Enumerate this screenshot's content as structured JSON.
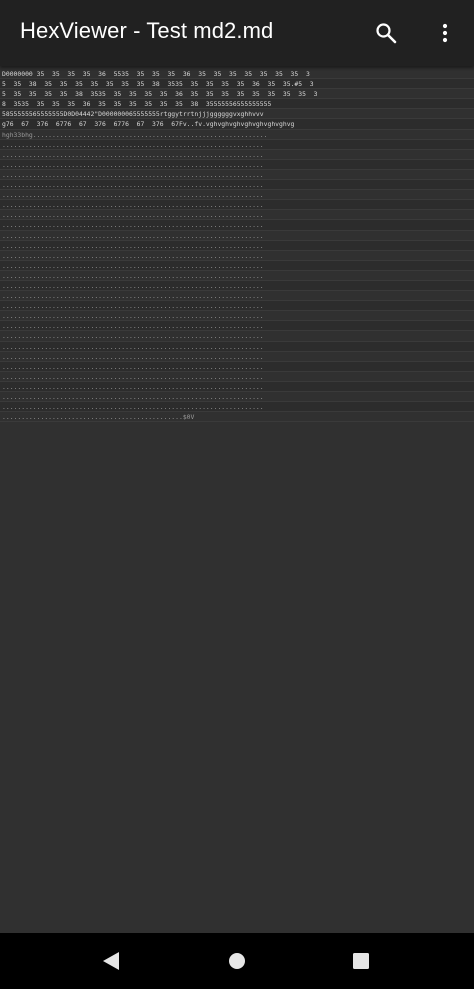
{
  "app_bar": {
    "title": "HexViewer - Test md2.md",
    "search_icon": "search-icon",
    "more_icon": "more-vert-icon"
  },
  "hex": {
    "lines": [
      "D0000000 35  35  35  35  36  5535  35  35  35  36  35  35  35  35  35  35  35  3",
      "5  35  38  35  35  35  35  35  35  35  38  3535  35  35  35  35  36  35  35.#5  3",
      "5  35  35  35  35  38  3535  35  35  35  35  36  35  35  35  35  35  35  35  35  3",
      "8  3535  35  35  35  36  35  35  35  35  35  35  38  35555556555555555",
      "5855555565555555D0D04442\"D000000065555555rtggytrrtnjjjggggggvxghhvvv",
      "g76  67  376  6776  67  376  6776  67  376  67Fv..fv.vghvghvghvghvghvghvghvg",
      "hgh33bhg.............................................................",
      "....................................................................",
      "....................................................................",
      "....................................................................",
      "....................................................................",
      "....................................................................",
      "....................................................................",
      "....................................................................",
      "....................................................................",
      "....................................................................",
      "....................................................................",
      "....................................................................",
      "....................................................................",
      "....................................................................",
      "....................................................................",
      "....................................................................",
      "....................................................................",
      "....................................................................",
      "....................................................................",
      "....................................................................",
      "....................................................................",
      "....................................................................",
      "....................................................................",
      "....................................................................",
      "....................................................................",
      "....................................................................",
      "....................................................................",
      "....................................................................",
      "...............................................$0V"
    ]
  },
  "nav": {
    "back_icon": "back-icon",
    "home_icon": "home-icon",
    "recents_icon": "recents-icon"
  },
  "colors": {
    "app_bar": "#212121",
    "background": "#303030",
    "nav_bar": "#000000"
  }
}
